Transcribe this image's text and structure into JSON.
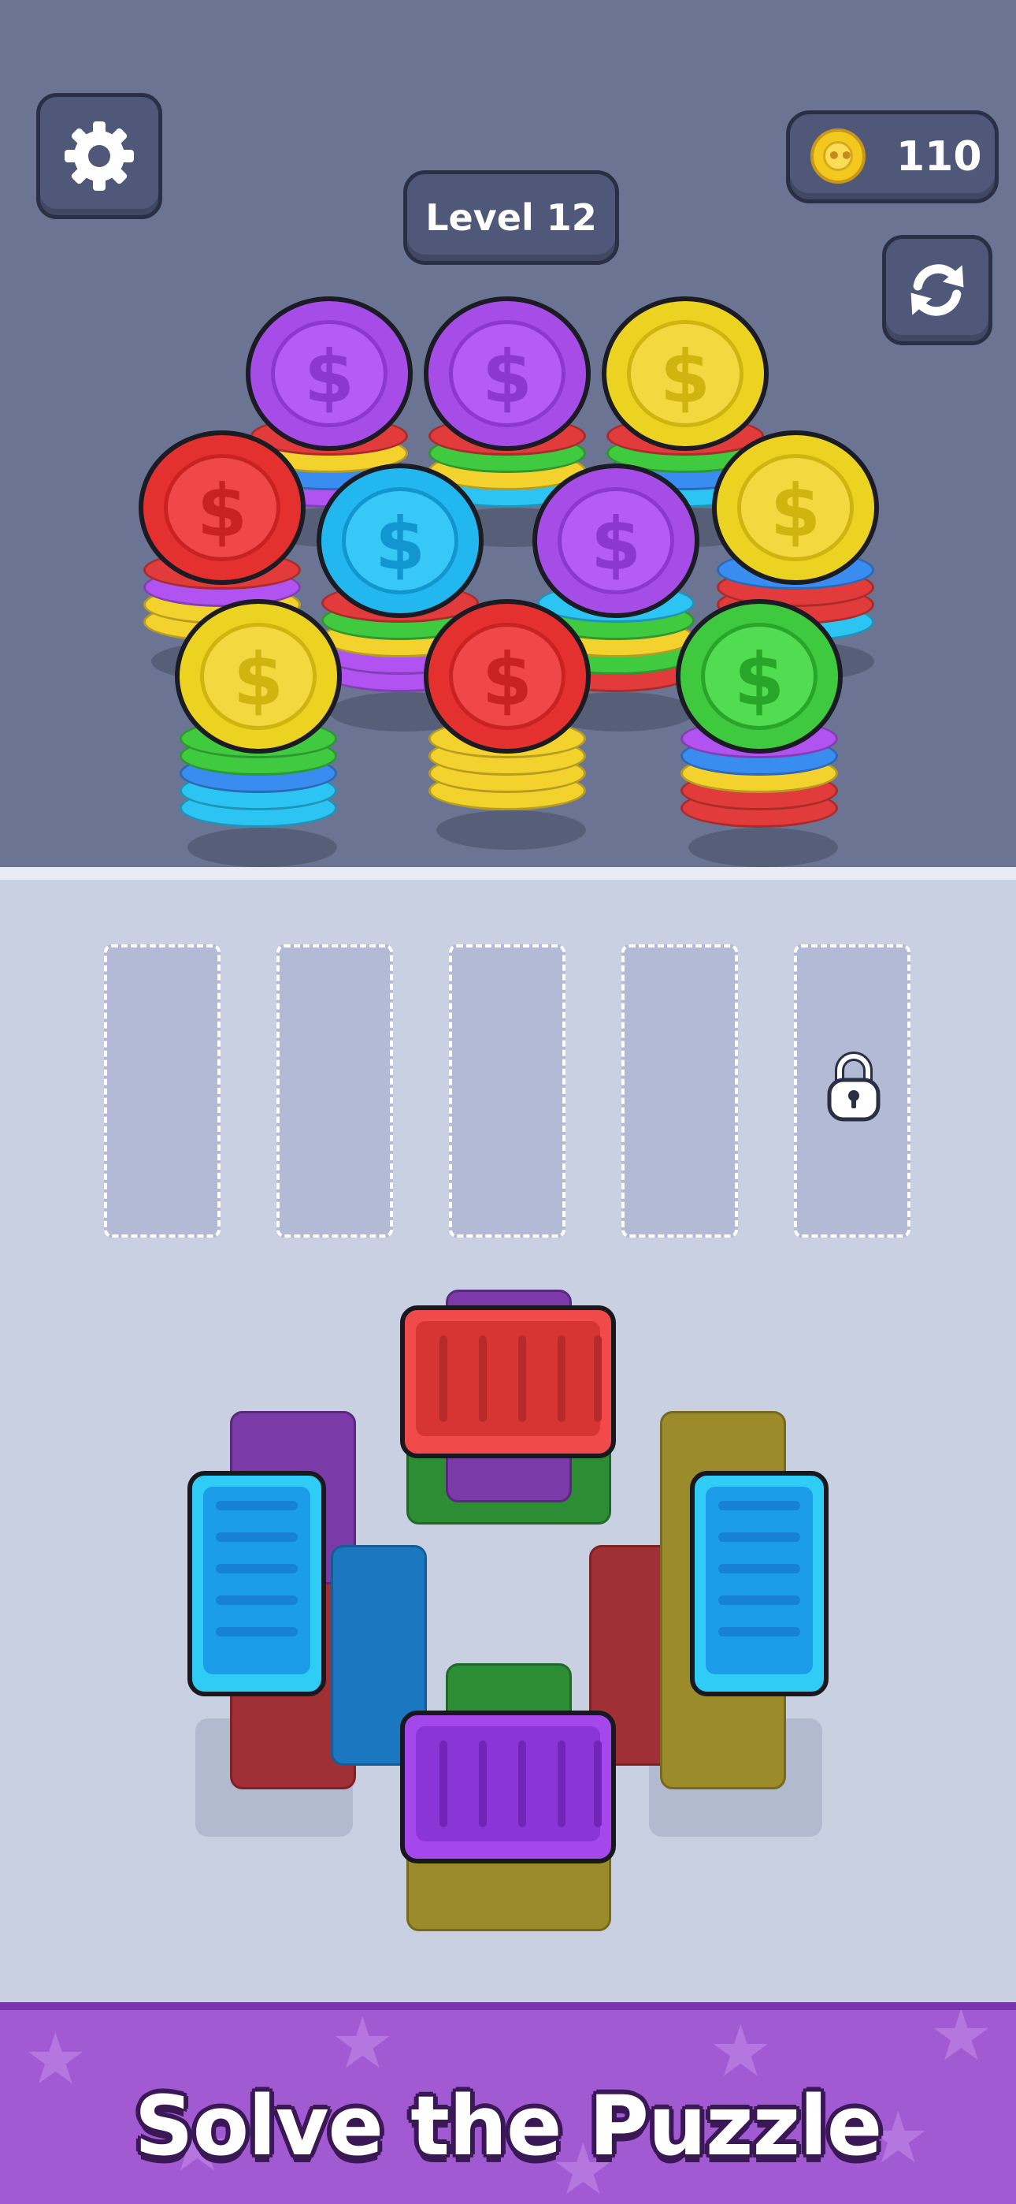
{
  "header": {
    "level_label": "Level 12",
    "coins": "110",
    "settings_icon": "gear-icon",
    "refresh_icon": "refresh-icon",
    "coin_icon": "coin-icon"
  },
  "board": {
    "coin_symbol": "$",
    "stacks": [
      {
        "top_color": "#a54de6",
        "layers": [
          "#e23b3b",
          "#f3d22e",
          "#3a8df0",
          "#b053f0"
        ]
      },
      {
        "top_color": "#a54de6",
        "layers": [
          "#e23b3b",
          "#3fca3f",
          "#f3d22e",
          "#2cc4f3"
        ]
      },
      {
        "top_color": "#ecd321",
        "layers": [
          "#e23b3b",
          "#3fca3f",
          "#3a8df0",
          "#2cc4f3"
        ]
      },
      {
        "top_color": "#e53030",
        "layers": [
          "#e23b3b",
          "#b053f0",
          "#f3d22e",
          "#f3d22e"
        ]
      },
      {
        "top_color": "#22b8ef",
        "layers": [
          "#e23b3b",
          "#3fca3f",
          "#f3d22e",
          "#b053f0",
          "#b053f0"
        ]
      },
      {
        "top_color": "#a54de6",
        "layers": [
          "#2cc4f3",
          "#3fca3f",
          "#f3d22e",
          "#3fca3f",
          "#e23b3b"
        ]
      },
      {
        "top_color": "#ecd321",
        "layers": [
          "#3a8df0",
          "#e23b3b",
          "#e23b3b",
          "#2cc4f3"
        ]
      },
      {
        "top_color": "#ecd321",
        "layers": [
          "#3fca3f",
          "#3fca3f",
          "#3a8df0",
          "#2cc4f3",
          "#2cc4f3"
        ]
      },
      {
        "top_color": "#e53030",
        "layers": [
          "#f3d22e",
          "#f3d22e",
          "#f3d22e",
          "#f3d22e"
        ]
      },
      {
        "top_color": "#3fc93f",
        "layers": [
          "#b053f0",
          "#3a8df0",
          "#f3d22e",
          "#e23b3b",
          "#e23b3b"
        ]
      }
    ]
  },
  "slots": {
    "count": 5,
    "locked_slot": 5,
    "lock_icon": "padlock-icon"
  },
  "crates": {
    "colors": {
      "red": "#f04a4a",
      "cyan": "#2fcdf6",
      "purple": "#a448ec"
    }
  },
  "banner": {
    "text": "Solve the Puzzle"
  }
}
